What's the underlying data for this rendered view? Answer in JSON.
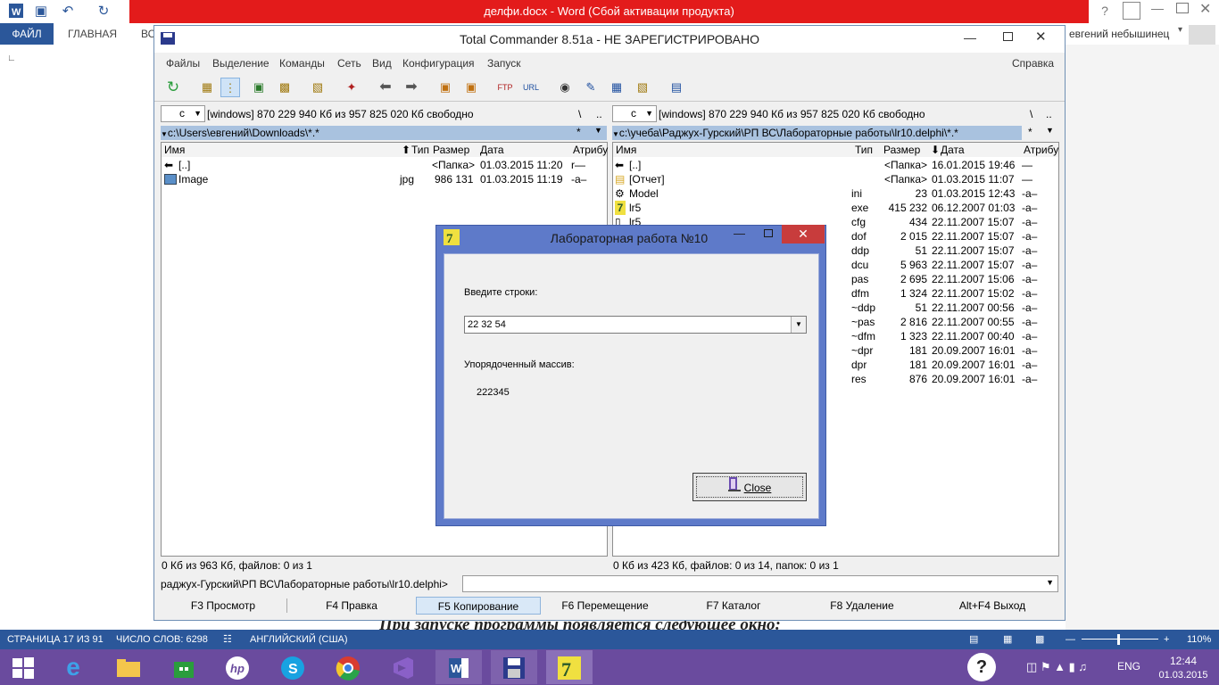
{
  "word": {
    "title": "делфи.docx -  Word (Сбой активации продукта)",
    "file_tab": "ФАЙЛ",
    "tabs": [
      "ГЛАВНАЯ",
      "ВС"
    ],
    "user": "евгений небышинец",
    "doc_text": "При запуске программы появляется следующее окно:",
    "status": {
      "page": "СТРАНИЦА 17 ИЗ 91",
      "words": "ЧИСЛО СЛОВ: 6298",
      "lang": "АНГЛИЙСКИЙ (США)",
      "zoom": "110%"
    }
  },
  "tc": {
    "title": "Total Commander 8.51a - НЕ ЗАРЕГИСТРИРОВАНО",
    "menu": [
      "Файлы",
      "Выделение",
      "Команды",
      "Сеть",
      "Вид",
      "Конфигурация",
      "Запуск"
    ],
    "help": "Справка",
    "left": {
      "drive": "c",
      "drive_info": "[windows]  870 229 940 Кб из 957 825 020 Кб свободно",
      "path": "c:\\Users\\евгений\\Downloads\\*.*",
      "headers": {
        "name": "Имя",
        "type": "Тип",
        "size": "Размер",
        "date": "Дата",
        "attr": "Атрибу"
      },
      "rows": [
        {
          "name": "[..]",
          "type": "",
          "size": "<Папка>",
          "date": "01.03.2015 11:20",
          "attr": "r—"
        },
        {
          "name": "Image",
          "type": "jpg",
          "size": "986 131",
          "date": "01.03.2015 11:19",
          "attr": "-a–"
        }
      ],
      "status": "0 Кб из 963 Кб, файлов: 0 из 1"
    },
    "right": {
      "drive": "c",
      "drive_info": "[windows]  870 229 940 Кб из 957 825 020 Кб свободно",
      "path": "c:\\учеба\\Раджух-Гурский\\РП ВС\\Лабораторные работы\\lr10.delphi\\*.*",
      "headers": {
        "name": "Имя",
        "type": "Тип",
        "size": "Размер",
        "date": "Дата",
        "attr": "Атрибу"
      },
      "rows": [
        {
          "name": "[..]",
          "type": "",
          "size": "<Папка>",
          "date": "16.01.2015 19:46",
          "attr": "—"
        },
        {
          "name": "[Отчет]",
          "type": "",
          "size": "<Папка>",
          "date": "01.03.2015 11:07",
          "attr": "—"
        },
        {
          "name": "Model",
          "type": "ini",
          "size": "23",
          "date": "01.03.2015 12:43",
          "attr": "-a–"
        },
        {
          "name": "lr5",
          "type": "exe",
          "size": "415 232",
          "date": "06.12.2007 01:03",
          "attr": "-a–"
        },
        {
          "name": "lr5",
          "type": "cfg",
          "size": "434",
          "date": "22.11.2007 15:07",
          "attr": "-a–"
        },
        {
          "name": "",
          "type": "dof",
          "size": "2 015",
          "date": "22.11.2007 15:07",
          "attr": "-a–"
        },
        {
          "name": "",
          "type": "ddp",
          "size": "51",
          "date": "22.11.2007 15:07",
          "attr": "-a–"
        },
        {
          "name": "",
          "type": "dcu",
          "size": "5 963",
          "date": "22.11.2007 15:07",
          "attr": "-a–"
        },
        {
          "name": "",
          "type": "pas",
          "size": "2 695",
          "date": "22.11.2007 15:06",
          "attr": "-a–"
        },
        {
          "name": "",
          "type": "dfm",
          "size": "1 324",
          "date": "22.11.2007 15:02",
          "attr": "-a–"
        },
        {
          "name": "",
          "type": "~ddp",
          "size": "51",
          "date": "22.11.2007 00:56",
          "attr": "-a–"
        },
        {
          "name": "",
          "type": "~pas",
          "size": "2 816",
          "date": "22.11.2007 00:55",
          "attr": "-a–"
        },
        {
          "name": "",
          "type": "~dfm",
          "size": "1 323",
          "date": "22.11.2007 00:40",
          "attr": "-a–"
        },
        {
          "name": "",
          "type": "~dpr",
          "size": "181",
          "date": "20.09.2007 16:01",
          "attr": "-a–"
        },
        {
          "name": "",
          "type": "dpr",
          "size": "181",
          "date": "20.09.2007 16:01",
          "attr": "-a–"
        },
        {
          "name": "",
          "type": "res",
          "size": "876",
          "date": "20.09.2007 16:01",
          "attr": "-a–"
        }
      ],
      "status": "0 Кб из 423 Кб, файлов: 0 из 14, папок: 0 из 1"
    },
    "cmd_path": "раджух-Гурский\\РП ВС\\Лабораторные работы\\lr10.delphi>",
    "fkeys": [
      "F3 Просмотр",
      "F4 Правка",
      "F5 Копирование",
      "F6 Перемещение",
      "F7 Каталог",
      "F8 Удаление",
      "Alt+F4 Выход"
    ]
  },
  "dialog": {
    "title": "Лабораторная работа №10",
    "input_label": "Введите строки:",
    "input_value": "22 32 54",
    "result_label": "Упорядоченный массив:",
    "result_value": "222345",
    "close_label": "Close"
  },
  "taskbar": {
    "lang": "ENG",
    "time": "12:44",
    "date": "01.03.2015"
  },
  "colors": {
    "word_blue": "#2b579a",
    "word_red": "#e31b1b",
    "dialog_frame": "#5e7ac9",
    "taskbar": "#6a4b9e",
    "path_bar": "#a9c2df"
  }
}
